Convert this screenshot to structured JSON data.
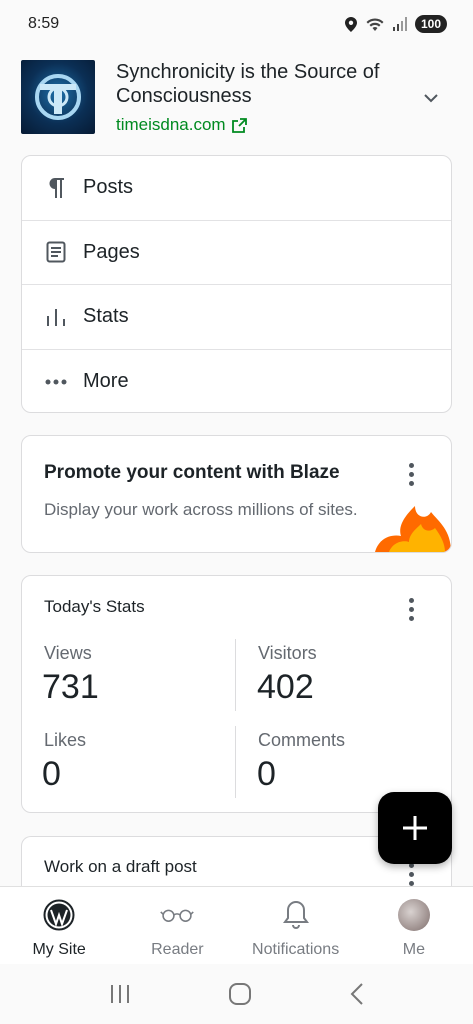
{
  "status_bar": {
    "time": "8:59",
    "battery": "100"
  },
  "site": {
    "title": "Synchronicity is the Source of Consciousness",
    "url": "timeisdna.com"
  },
  "menu": [
    {
      "label": "Posts",
      "icon": "paragraph-icon"
    },
    {
      "label": "Pages",
      "icon": "page-icon"
    },
    {
      "label": "Stats",
      "icon": "stats-icon"
    },
    {
      "label": "More",
      "icon": "more-icon"
    }
  ],
  "blaze": {
    "title": "Promote your content with Blaze",
    "description": "Display your work across millions of sites."
  },
  "stats": {
    "title": "Today's Stats",
    "views_label": "Views",
    "views": "731",
    "visitors_label": "Visitors",
    "visitors": "402",
    "likes_label": "Likes",
    "likes": "0",
    "comments_label": "Comments",
    "comments": "0"
  },
  "draft": {
    "title": "Work on a draft post"
  },
  "nav": [
    {
      "label": "My Site",
      "icon": "wordpress-icon"
    },
    {
      "label": "Reader",
      "icon": "glasses-icon"
    },
    {
      "label": "Notifications",
      "icon": "bell-icon"
    },
    {
      "label": "Me",
      "icon": "avatar"
    }
  ],
  "colors": {
    "accent_green": "#008a20",
    "fab": "#000000"
  }
}
